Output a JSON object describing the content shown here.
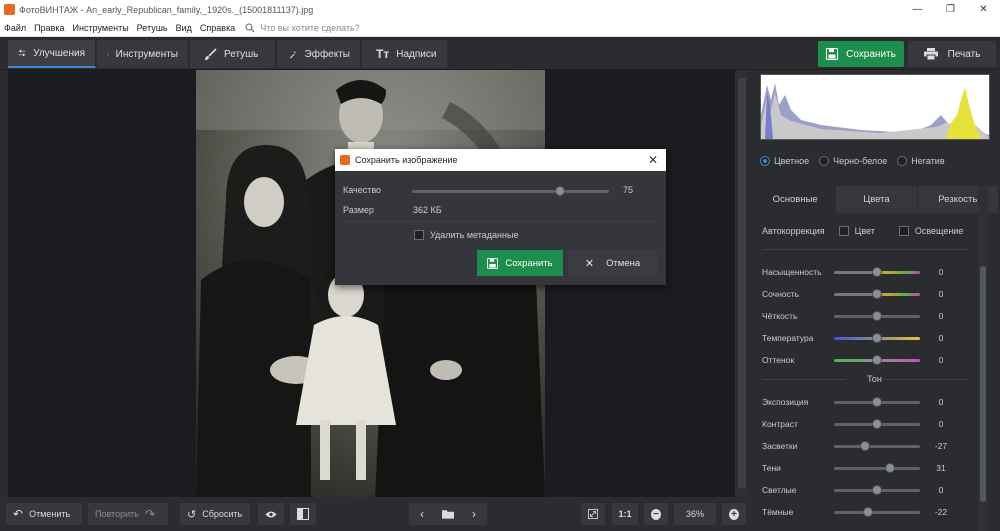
{
  "window": {
    "title": "ФотоВИНТАЖ - An_early_Republican_family,_1920s._(15001811137).jpg",
    "minimize": "—",
    "maximize": "❐",
    "close": "✕"
  },
  "menu": {
    "items": [
      "Файл",
      "Правка",
      "Инструменты",
      "Ретушь",
      "Вид",
      "Справка"
    ],
    "search_placeholder": "Что вы хотите сделать?"
  },
  "tabs": [
    {
      "label": "Улучшения",
      "icon": "sliders-icon",
      "active": true
    },
    {
      "label": "Инструменты",
      "icon": "crop-icon",
      "active": false
    },
    {
      "label": "Ретушь",
      "icon": "brush-icon",
      "active": false
    },
    {
      "label": "Эффекты",
      "icon": "magic-wand-icon",
      "active": false
    },
    {
      "label": "Надписи",
      "icon": "text-icon",
      "active": false
    }
  ],
  "actions": {
    "save": "Сохранить",
    "print": "Печать"
  },
  "color_modes": {
    "items": [
      "Цветное",
      "Черно-белое",
      "Негатив"
    ],
    "selected": "Цветное"
  },
  "panel_tabs": [
    "Основные",
    "Цвета",
    "Резкость"
  ],
  "autocorrection": {
    "label": "Автокоррекция",
    "color": "Цвет",
    "lighting": "Освещение"
  },
  "adjustments": [
    {
      "label": "Насыщенность",
      "value": 0,
      "track": "sat"
    },
    {
      "label": "Сочность",
      "value": 0,
      "track": "sat"
    },
    {
      "label": "Чёткость",
      "value": 0,
      "track": "gray"
    },
    {
      "label": "Температура",
      "value": 0,
      "track": "temp"
    },
    {
      "label": "Оттенок",
      "value": 0,
      "track": "tint"
    }
  ],
  "tone": {
    "heading": "Тон",
    "items": [
      {
        "label": "Экспозиция",
        "value": 0
      },
      {
        "label": "Контраст",
        "value": 0
      },
      {
        "label": "Засветки",
        "value": -27
      },
      {
        "label": "Тени",
        "value": 31
      },
      {
        "label": "Светлые",
        "value": 0
      },
      {
        "label": "Тёмные",
        "value": -22
      }
    ]
  },
  "bottom": {
    "undo": "Отменить",
    "redo": "Повторить",
    "reset": "Сбросить",
    "ratio": "1:1",
    "zoom": "36%"
  },
  "dialog": {
    "title": "Сохранить изображение",
    "quality_label": "Качество",
    "quality_value": 75,
    "size_label": "Размер",
    "size_value": "362 КБ",
    "remove_metadata": "Удалить метаданные",
    "save": "Сохранить",
    "cancel": "Отмена"
  },
  "colors": {
    "accent": "#3a8ad4",
    "save_green": "#1e8e4c",
    "bg": "#2b2c30"
  }
}
